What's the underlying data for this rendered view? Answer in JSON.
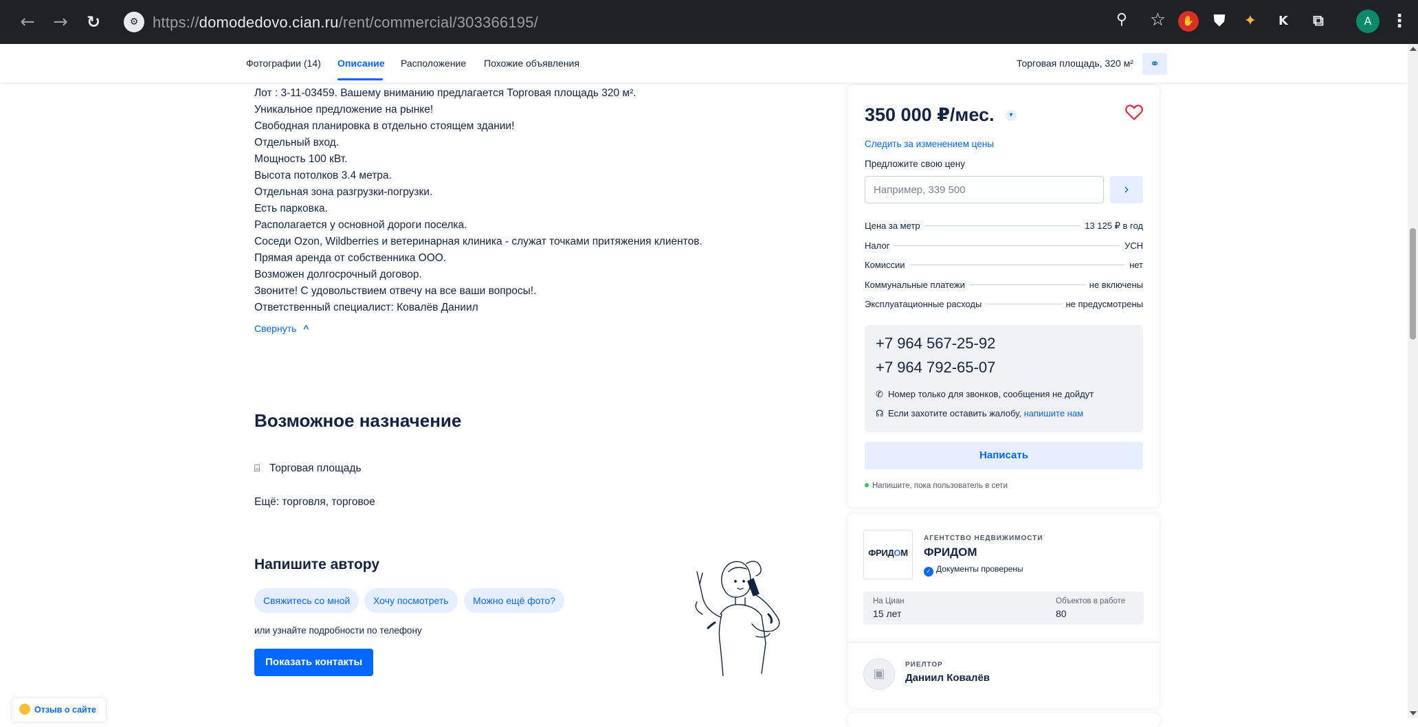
{
  "browser": {
    "url_prefix": "https://",
    "url_host": "domodedovo.cian.ru",
    "url_path": "/rent/commercial/303366195/",
    "back_icon": "←",
    "forward_icon": "→",
    "reload_icon": "↻",
    "avatar_letter": "A",
    "extension_k": "K"
  },
  "nav": {
    "tabs": [
      "Фотографии (14)",
      "Описание",
      "Расположение",
      "Похожие объявления"
    ],
    "object_title": "Торговая площадь, 320 м²"
  },
  "description": {
    "lines": [
      "Лот : 3-11-03459. Вашему вниманию предлагается Торговая площадь 320 м².",
      "Уникальное предложение на рынке!",
      "Свободная планировка в отдельно стоящем здании!",
      "Отдельный вход.",
      "Мощность 100 кВт.",
      "Высота потолков 3.4 метра.",
      "Отдельная зона разгрузки-погрузки.",
      "Есть парковка.",
      "Располагается у основной дороги поселка.",
      "Соседи Ozon, Wildberries и ветеринарная клиника - служат точками притяжения клиентов.",
      "Прямая аренда от собственника ООО.",
      "Возможен долгосрочный договор.",
      "Звоните! С удовольствием отвечу на все ваши вопросы!.",
      "Ответственный специалист: Ковалёв Даниил"
    ],
    "collapse_label": "Свернуть",
    "collapse_icon": "^"
  },
  "purpose": {
    "title": "Возможное назначение",
    "item": "Торговая площадь",
    "more": "Ещё: торговля, торговое"
  },
  "contact_author": {
    "title": "Напишите автору",
    "chips": [
      "Свяжитесь со мной",
      "Хочу посмотреть",
      "Можно ещё фото?"
    ],
    "phone_hint": "или узнайте подробности по телефону",
    "show_contacts": "Показать контакты"
  },
  "feedback": {
    "label": "Отзыв о сайте"
  },
  "price_card": {
    "price": "350 000 ₽/мес.",
    "follow_label": "Следить за изменением цены",
    "propose_label": "Предложите свою цену",
    "input_placeholder": "Например, 339 500",
    "terms": [
      {
        "key": "Цена за метр",
        "value": "13 125 ₽ в год"
      },
      {
        "key": "Налог",
        "value": "УСН"
      },
      {
        "key": "Комиссии",
        "value": "нет"
      },
      {
        "key": "Коммунальные платежи",
        "value": "не включены"
      },
      {
        "key": "Эксплуатационные расходы",
        "value": "не предусмотрены"
      }
    ],
    "phones": [
      "+7 964 567-25-92",
      "+7 964 792-65-07"
    ],
    "calls_note": "Номер только для звонков, сообщения не дойдут",
    "complaint_note": "Если захотите оставить жалобу,",
    "complaint_link": "напишите нам",
    "write_button": "Написать",
    "online_note": "Напишите, пока пользователь в сети"
  },
  "agency": {
    "logo_text_a": "ФРИД",
    "logo_text_o": "О",
    "logo_text_b": "М",
    "caption": "АГЕНТСТВО НЕДВИЖИМОСТИ",
    "name": "ФРИДОМ",
    "verified": "Документы проверены",
    "stat1_label": "На Циан",
    "stat1_value": "15 лет",
    "stat2_label": "Объектов в работе",
    "stat2_value": "80"
  },
  "realtor": {
    "caption": "РИЕЛТОР",
    "name": "Даниил Ковалёв"
  },
  "colors": {
    "accent": "#0468ff",
    "accent_light": "#e6efff",
    "text": "#152242",
    "heart": "#e8273b",
    "online": "#34c759"
  }
}
